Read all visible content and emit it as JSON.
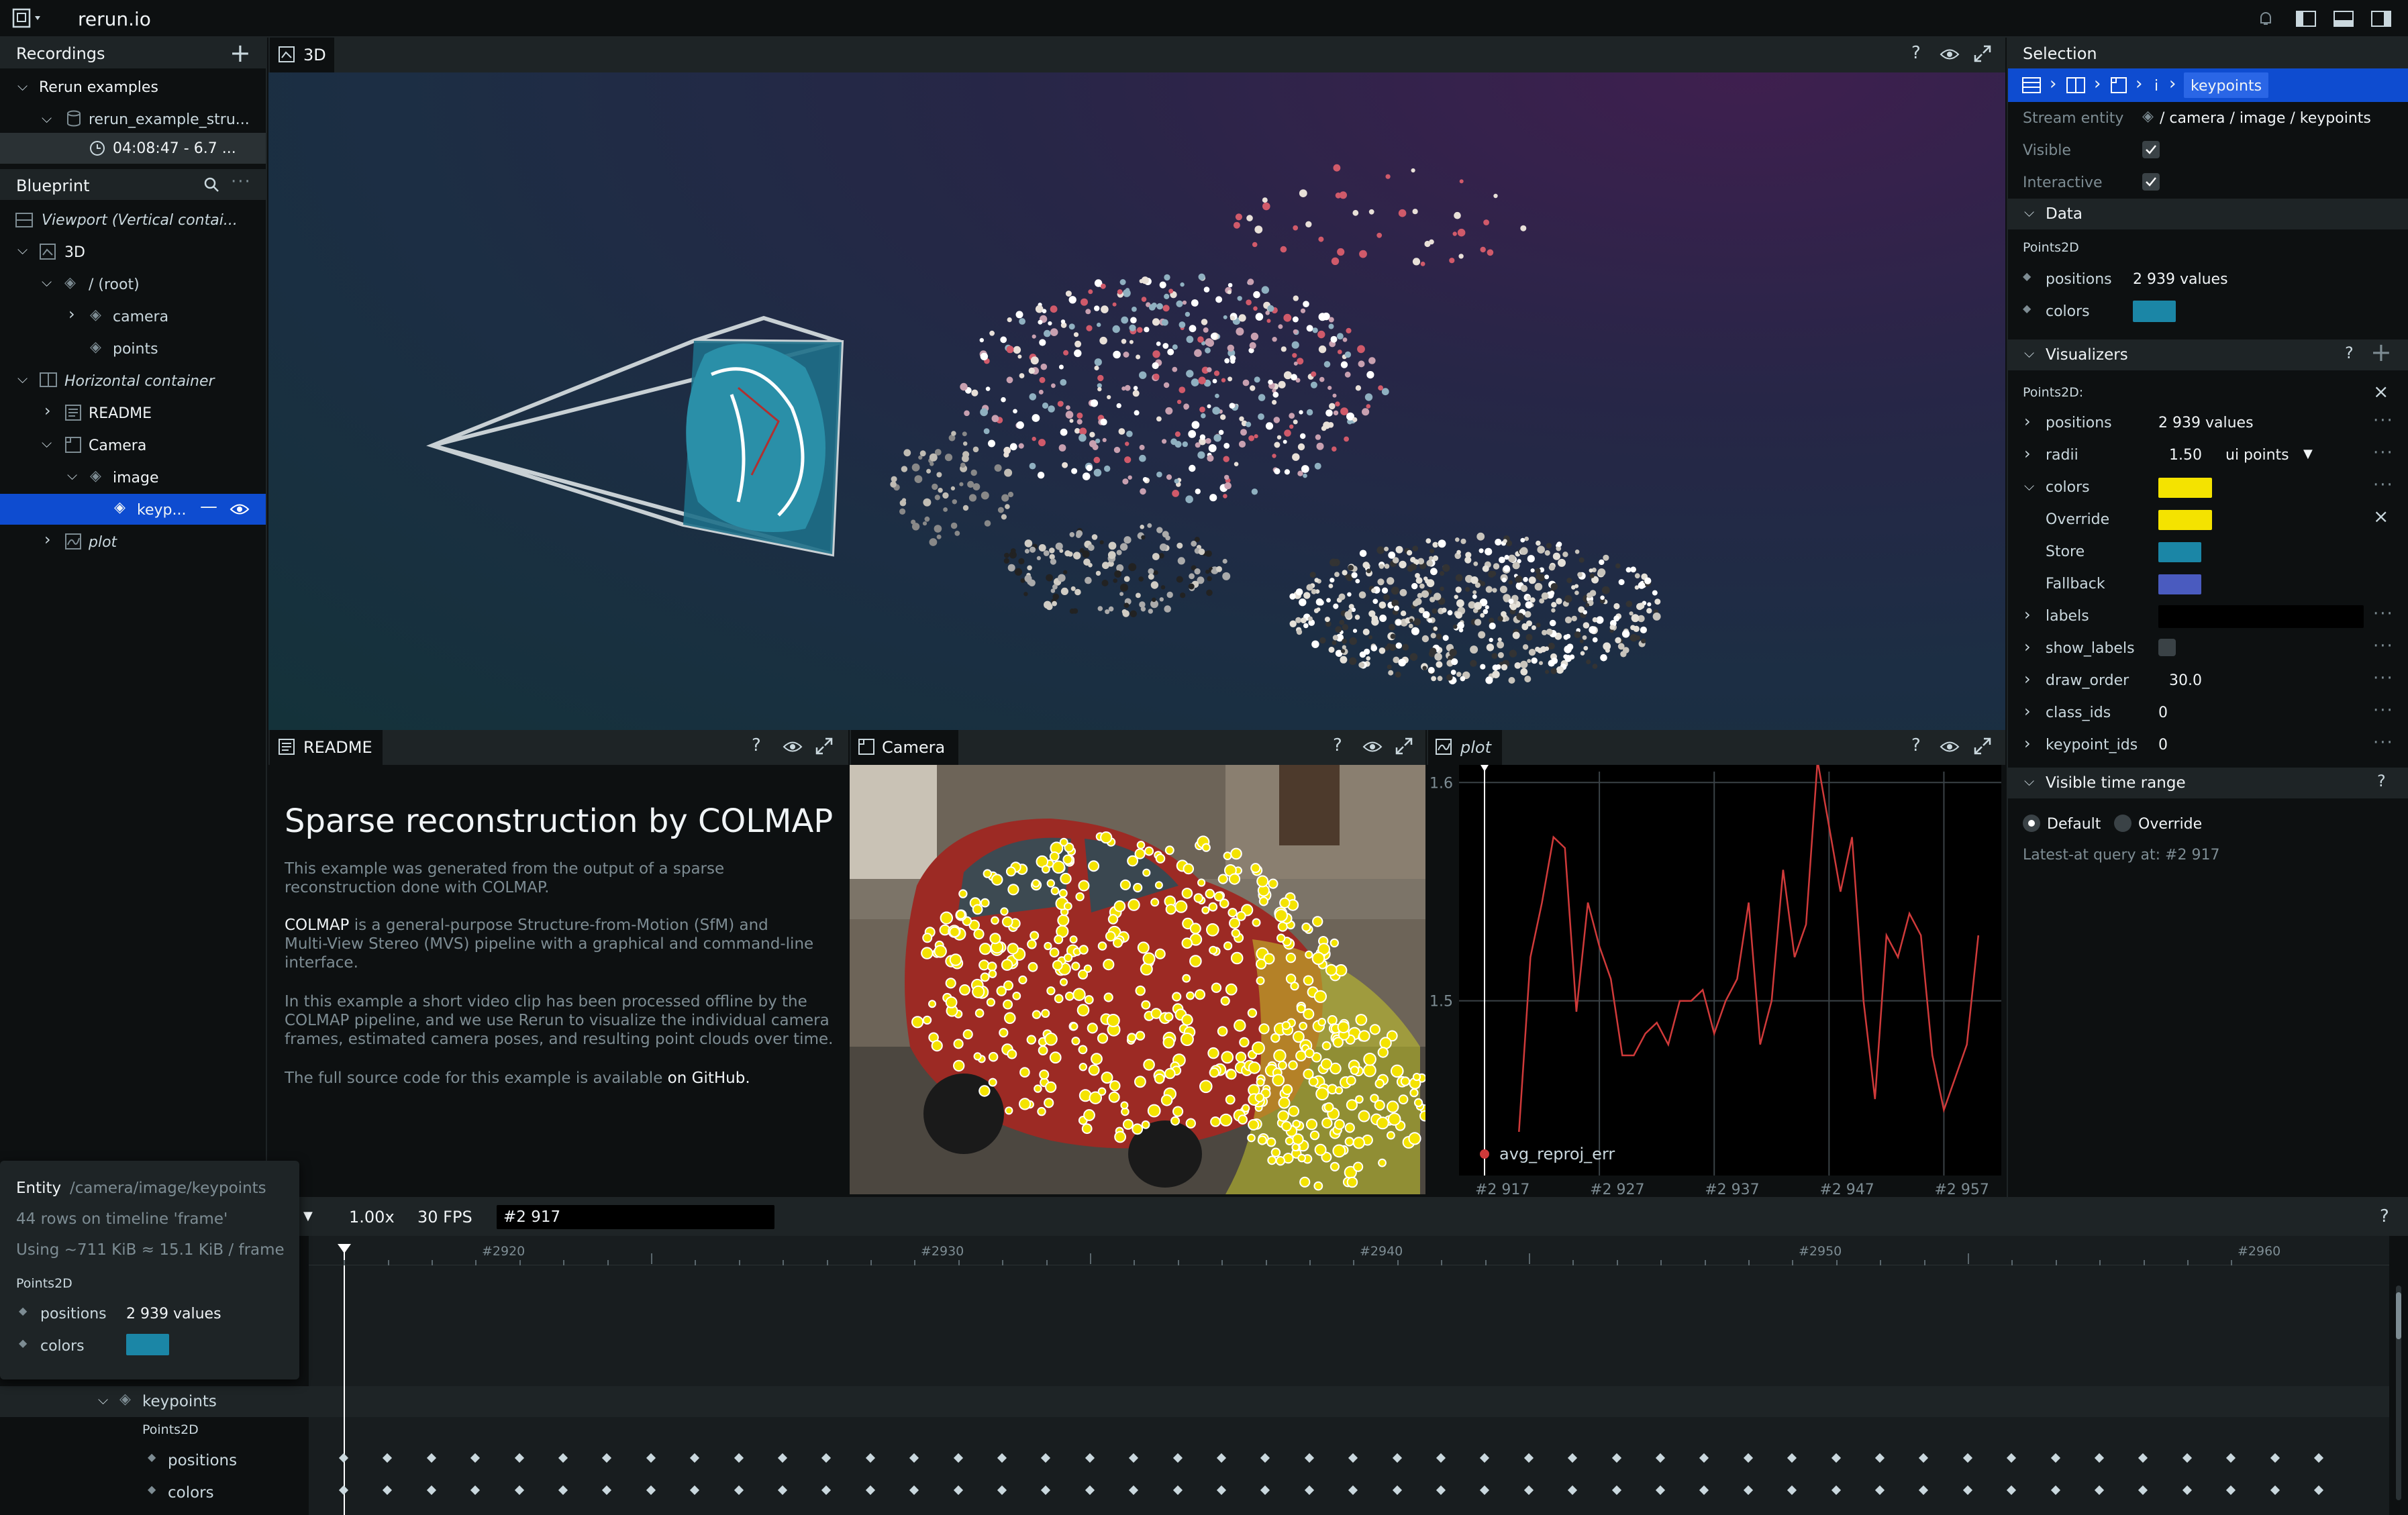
{
  "topbar": {
    "app_name": "rerun.io"
  },
  "recordings": {
    "title": "Recordings",
    "group": "Rerun examples",
    "recording": "rerun_example_stru...",
    "time": "04:08:47 - 6.7 ..."
  },
  "blueprint": {
    "title": "Blueprint",
    "items": [
      {
        "label": "Viewport (Vertical contai..."
      },
      {
        "label": "3D"
      },
      {
        "label": "/ (root)"
      },
      {
        "label": "camera"
      },
      {
        "label": "points"
      },
      {
        "label": "Horizontal container"
      },
      {
        "label": "README"
      },
      {
        "label": "Camera"
      },
      {
        "label": "image"
      },
      {
        "label": "keyp..."
      },
      {
        "label": "plot"
      }
    ]
  },
  "views": {
    "view3d": "3D",
    "readme": "README",
    "camera": "Camera",
    "plot": "plot"
  },
  "readme": {
    "title": "Sparse reconstruction by COLMAP",
    "p1": "This example was generated from the output of a sparse",
    "p1b": "reconstruction done with COLMAP.",
    "p2a": "COLMAP",
    "p2": " is a general-purpose Structure-from-Motion (SfM) and",
    "p2b": "Multi-View Stereo (MVS) pipeline with a graphical and command-line",
    "p2c": "interface.",
    "p3": "In this example a short video clip has been processed offline by the",
    "p3b": "COLMAP pipeline, and we use Rerun to visualize the individual camera",
    "p3c": "frames, estimated camera poses, and resulting point clouds over time.",
    "p4": "The full source code for this example is available ",
    "p4link": "on GitHub."
  },
  "plot": {
    "y_ticks": [
      "1.6",
      "1.5"
    ],
    "x_ticks": [
      "#2 917",
      "#2 927",
      "#2 937",
      "#2 947",
      "#2 957"
    ],
    "legend": "avg_reproj_err"
  },
  "chart_data": {
    "type": "line",
    "title": "",
    "xlabel": "",
    "ylabel": "",
    "ylim": [
      1.42,
      1.605
    ],
    "x": [
      2920,
      2921,
      2922,
      2923,
      2924,
      2925,
      2926,
      2927,
      2928,
      2929,
      2930,
      2931,
      2932,
      2933,
      2934,
      2935,
      2936,
      2937,
      2938,
      2939,
      2940,
      2941,
      2942,
      2943,
      2944,
      2945,
      2946,
      2947,
      2948,
      2949,
      2950,
      2951,
      2952,
      2953,
      2954,
      2955,
      2956,
      2957,
      2958,
      2959,
      2960
    ],
    "series": [
      {
        "name": "avg_reproj_err",
        "values": [
          1.44,
          1.52,
          1.545,
          1.575,
          1.57,
          1.495,
          1.545,
          1.525,
          1.51,
          1.475,
          1.475,
          1.485,
          1.49,
          1.48,
          1.5,
          1.5,
          1.505,
          1.485,
          1.5,
          1.51,
          1.545,
          1.48,
          1.5,
          1.56,
          1.52,
          1.535,
          1.61,
          1.58,
          1.55,
          1.575,
          1.5,
          1.455,
          1.53,
          1.52,
          1.54,
          1.53,
          1.475,
          1.45,
          1.465,
          1.48,
          1.53
        ]
      }
    ]
  },
  "selection": {
    "title": "Selection",
    "crumb_i": "i",
    "crumb_last": "keypoints",
    "stream_entity_label": "Stream entity",
    "stream_entity": "/ camera / image / keypoints",
    "visible_label": "Visible",
    "interactive_label": "Interactive",
    "data_title": "Data",
    "data_archetype": "Points2D",
    "positions_label": "positions",
    "positions_value": "2 939 values",
    "colors_label": "colors",
    "visualizers_title": "Visualizers",
    "vis_archetype": "Points2D:",
    "vis_rows": [
      {
        "label": "positions",
        "value": "2 939 values"
      },
      {
        "label": "radii",
        "value": "1.50",
        "extra": "ui points"
      },
      {
        "label": "colors"
      },
      {
        "label": "Override"
      },
      {
        "label": "Store"
      },
      {
        "label": "Fallback"
      },
      {
        "label": "labels"
      },
      {
        "label": "show_labels"
      },
      {
        "label": "draw_order",
        "value": "30.0"
      },
      {
        "label": "class_ids",
        "value": "0"
      },
      {
        "label": "keypoint_ids",
        "value": "0"
      }
    ],
    "time_range_title": "Visible time range",
    "default_label": "Default",
    "override_label": "Override",
    "latest_at": "Latest-at query at: #2 917"
  },
  "colors": {
    "store": "#1b86a6",
    "override": "#f4e300",
    "fallback": "#4a5bbf",
    "accent": "#0e4cd0"
  },
  "timeline": {
    "speed": "1.00x",
    "fps": "30 FPS",
    "frame": "#2 917",
    "ticks": [
      "#2920",
      "#2930",
      "#2940",
      "#2950",
      "#2960"
    ],
    "tree_entity": "keypoints",
    "tree_archetype": "Points2D",
    "tree_positions": "positions",
    "tree_colors": "colors"
  },
  "tooltip": {
    "entity_label": "Entity",
    "path": [
      "/camera",
      "/image",
      "/keypoints"
    ],
    "rows_info": "44 rows on timeline 'frame'",
    "using_info": "Using ~711 KiB ≈ 15.1 KiB / frame",
    "archetype": "Points2D",
    "positions_label": "positions",
    "positions_value": "2 939 values",
    "colors_label": "colors"
  }
}
